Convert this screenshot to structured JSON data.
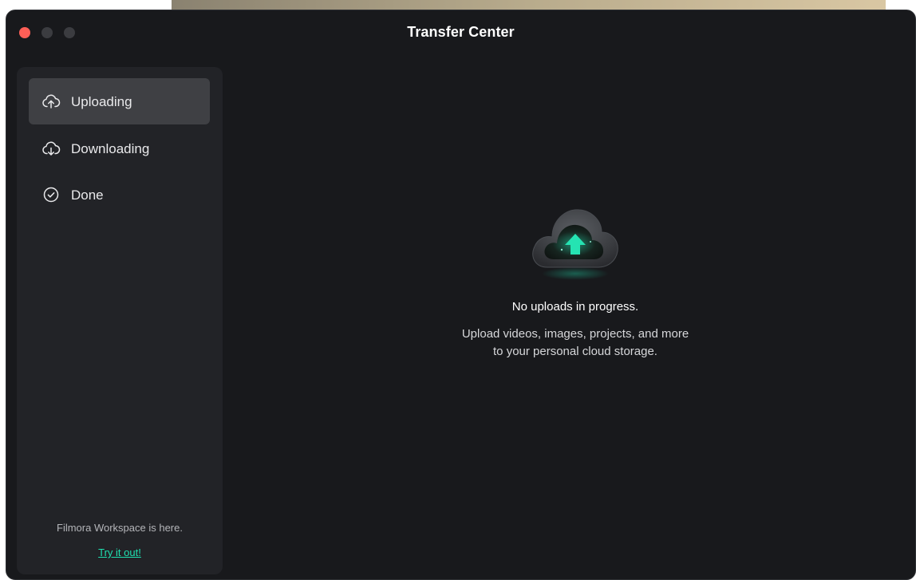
{
  "window": {
    "title": "Transfer Center"
  },
  "sidebar": {
    "items": [
      {
        "label": "Uploading",
        "icon": "cloud-upload-icon",
        "active": true
      },
      {
        "label": "Downloading",
        "icon": "cloud-download-icon",
        "active": false
      },
      {
        "label": "Done",
        "icon": "check-circle-icon",
        "active": false
      }
    ],
    "promo_text": "Filmora Workspace is here.",
    "promo_link": "Try it out!"
  },
  "main": {
    "empty_state": {
      "icon": "cloud-upload-illustration",
      "title": "No uploads in progress.",
      "description_line1": "Upload videos, images, projects, and more",
      "description_line2": "to your personal cloud storage."
    }
  },
  "colors": {
    "accent": "#1fe0b0",
    "window_bg": "#18191c",
    "sidebar_bg": "#222327",
    "active_item_bg": "#3f4044",
    "close_button": "#fe5f57"
  }
}
